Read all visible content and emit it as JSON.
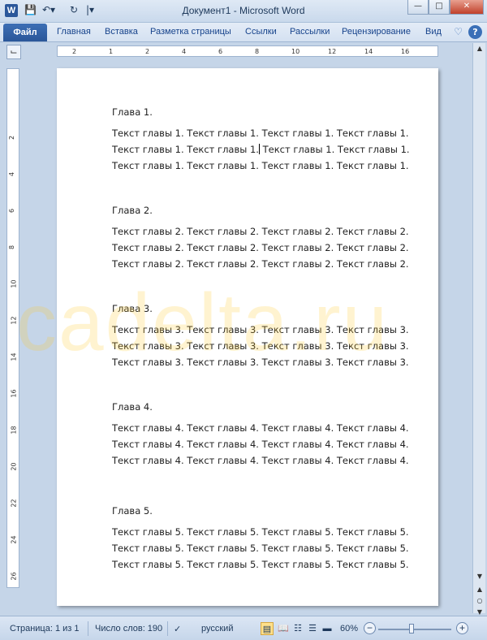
{
  "window": {
    "title": "Документ1  -  Microsoft Word",
    "app_icon": "W",
    "quick_access": [
      "save-icon",
      "undo-icon",
      "redo-icon",
      "customize-icon"
    ]
  },
  "ribbon": {
    "file_tab": "Файл",
    "tabs": [
      "Главная",
      "Вставка",
      "Разметка страницы",
      "Ссылки",
      "Рассылки",
      "Рецензирование",
      "Вид"
    ]
  },
  "document": {
    "chapters": [
      {
        "heading": "Глава 1.",
        "lines": [
          "Текст главы 1. Текст главы 1. Текст главы 1. Текст главы 1.",
          "Текст главы 1. Текст главы 1.",
          "Текст главы 1. Текст главы 1. Текст главы 1. Текст главы 1. Текст главы 1. Текст главы 1."
        ]
      },
      {
        "heading": "Глава 2.",
        "lines": [
          "Текст главы 2. Текст главы 2. Текст главы 2. Текст главы 2.",
          "Текст главы 2. Текст главы 2. Текст главы 2. Текст главы 2.",
          "Текст главы 2. Текст главы 2. Текст главы 2. Текст главы 2."
        ]
      },
      {
        "heading": "Глава 3.",
        "lines": [
          "Текст главы 3. Текст главы 3. Текст главы 3. Текст главы 3.",
          "Текст главы 3. Текст главы 3. Текст главы 3. Текст главы 3.",
          "Текст главы 3. Текст главы 3. Текст главы 3. Текст главы 3."
        ]
      },
      {
        "heading": "Глава 4.",
        "lines": [
          "Текст главы 4. Текст главы 4. Текст главы 4. Текст главы 4.",
          "Текст главы 4. Текст главы 4. Текст главы 4. Текст главы 4.",
          "Текст главы 4. Текст главы 4. Текст главы 4. Текст главы 4."
        ]
      },
      {
        "heading": "Глава 5.",
        "lines": [
          "Текст главы 5. Текст главы 5. Текст главы 5. Текст главы 5.",
          "Текст главы 5. Текст главы 5. Текст главы 5. Текст главы 5.",
          "Текст главы 5. Текст главы 5. Текст главы 5. Текст главы 5."
        ]
      }
    ],
    "caret_line_after": "Текст главы 1. Текст главы 1.",
    "caret_line_rest": "Текст главы 1. Текст главы 1."
  },
  "watermark": "cadelta.ru",
  "ruler": {
    "h_ticks": [
      "2",
      "1",
      "2",
      "4",
      "6",
      "8",
      "10",
      "12",
      "14",
      "16"
    ],
    "v_ticks": [
      "2",
      "4",
      "6",
      "8",
      "10",
      "12",
      "14",
      "16",
      "18",
      "20",
      "22",
      "24",
      "26"
    ]
  },
  "status": {
    "page": "Страница: 1 из 1",
    "words": "Число слов: 190",
    "language": "русский",
    "zoom": "60%",
    "zoom_level_fraction": 0.45
  }
}
